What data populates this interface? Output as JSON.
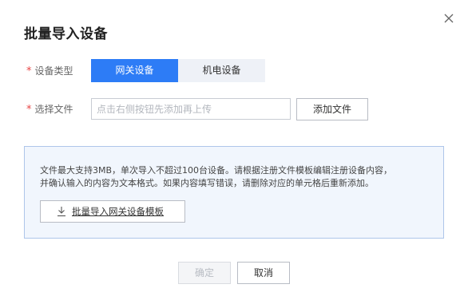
{
  "dialog": {
    "title": "批量导入设备",
    "close_icon": "close-icon"
  },
  "device_type": {
    "label": "设备类型",
    "required_mark": "*",
    "options": [
      {
        "label": "网关设备",
        "selected": true
      },
      {
        "label": "机电设备",
        "selected": false
      }
    ]
  },
  "file_select": {
    "label": "选择文件",
    "required_mark": "*",
    "value": "",
    "placeholder": "点击右侧按钮先添加再上传",
    "add_button_label": "添加文件"
  },
  "info_box": {
    "line1": "文件最大支持3MB，单次导入不超过100台设备。请根据注册文件模板编辑注册设备内容，",
    "line2": "并确认输入的内容为文本格式。如果内容填写错误，请删除对应的单元格后重新添加。",
    "template_button_label": "批量导入网关设备模板",
    "template_button_icon": "download-icon"
  },
  "footer": {
    "ok_label": "确定",
    "ok_disabled": true,
    "cancel_label": "取消"
  },
  "colors": {
    "accent": "#2d7cf6",
    "required": "#e84545",
    "info_border": "#aec6ea",
    "info_bg": "#f1f6fd"
  }
}
